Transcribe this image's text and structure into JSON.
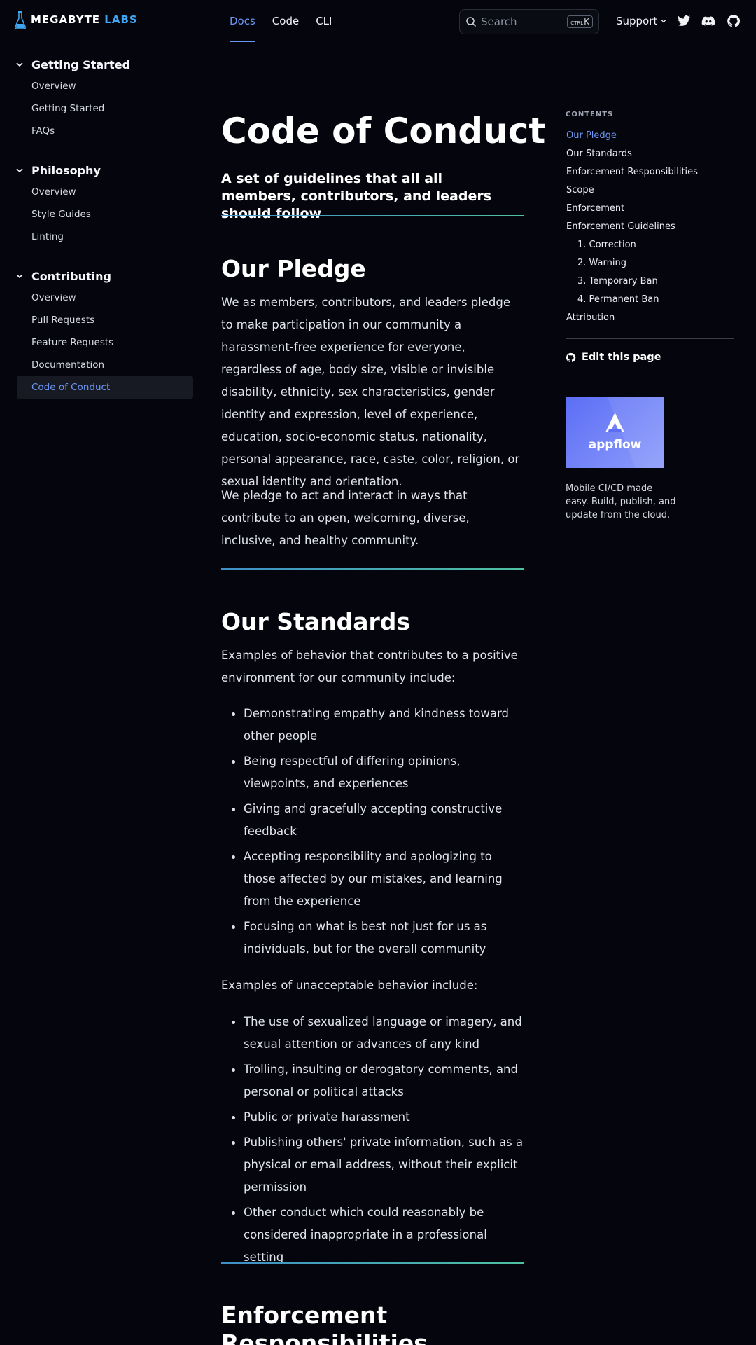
{
  "header": {
    "logo_word1": "MEGABYTE",
    "logo_word2": "LABS",
    "nav": [
      "Docs",
      "Code",
      "CLI"
    ],
    "search_placeholder": "Search",
    "kbd_ctrl": "CTRL",
    "kbd_key": "K",
    "support": "Support"
  },
  "sidebar": {
    "sections": [
      {
        "title": "Getting Started",
        "items": [
          "Overview",
          "Getting Started",
          "FAQs"
        ]
      },
      {
        "title": "Philosophy",
        "items": [
          "Overview",
          "Style Guides",
          "Linting"
        ]
      },
      {
        "title": "Contributing",
        "items": [
          "Overview",
          "Pull Requests",
          "Feature Requests",
          "Documentation",
          "Code of Conduct"
        ]
      }
    ]
  },
  "main": {
    "title": "Code of Conduct",
    "subtitle": "A set of guidelines that all all members, contributors, and leaders should follow",
    "pledge_heading": "Our Pledge",
    "pledge_p1": "We as members, contributors, and leaders pledge to make participation in our community a harassment-free experience for everyone, regardless of age, body size, visible or invisible disability, ethnicity, sex characteristics, gender identity and expression, level of experience, education, socio-economic status, nationality, personal appearance, race, caste, color, religion, or sexual identity and orientation.",
    "pledge_p2": "We pledge to act and interact in ways that contribute to an open, welcoming, diverse, inclusive, and healthy community.",
    "standards_heading": "Our Standards",
    "standards_intro": "Examples of behavior that contributes to a positive environment for our community include:",
    "positive": [
      "Demonstrating empathy and kindness toward other people",
      "Being respectful of differing opinions, viewpoints, and experiences",
      "Giving and gracefully accepting constructive feedback",
      "Accepting responsibility and apologizing to those affected by our mistakes, and learning from the experience",
      "Focusing on what is best not just for us as individuals, but for the overall community"
    ],
    "negative_intro": "Examples of unacceptable behavior include:",
    "negative": [
      "The use of sexualized language or imagery, and sexual attention or advances of any kind",
      "Trolling, insulting or derogatory comments, and personal or political attacks",
      "Public or private harassment",
      "Publishing others' private information, such as a physical or email address, without their explicit permission",
      "Other conduct which could reasonably be considered inappropriate in a professional setting"
    ],
    "enforcement_heading": "Enforcement Responsibilities"
  },
  "toc": {
    "title": "CONTENTS",
    "items": [
      "Our Pledge",
      "Our Standards",
      "Enforcement Responsibilities",
      "Scope",
      "Enforcement",
      "Enforcement Guidelines",
      "1. Correction",
      "2. Warning",
      "3. Temporary Ban",
      "4. Permanent Ban",
      "Attribution"
    ],
    "edit": "Edit this page",
    "ad_brand": "appflow",
    "ad_text": "Mobile CI/CD made easy. Build, publish, and update from the cloud."
  },
  "colors": {
    "accent": "#6b96f2",
    "background": "#05060d",
    "logo_blue": "#3ea6f2"
  }
}
